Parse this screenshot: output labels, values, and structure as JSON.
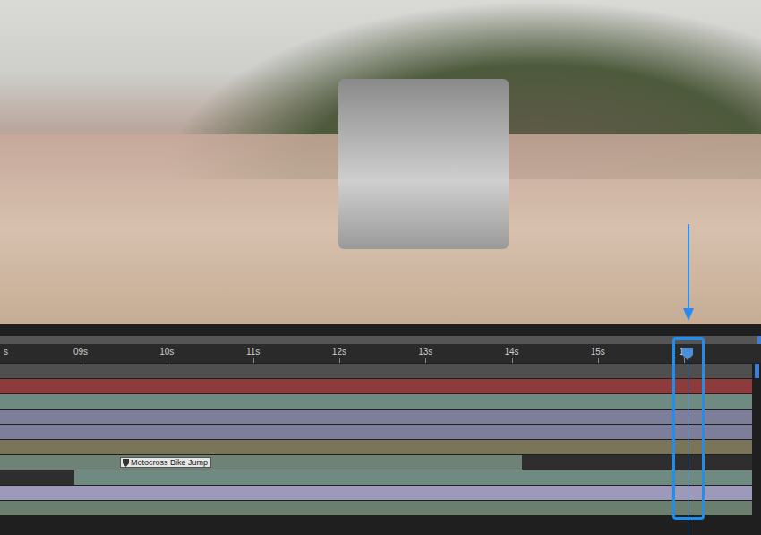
{
  "viewer": {
    "content": "photo"
  },
  "ruler": {
    "ticks": [
      "s",
      "09s",
      "10s",
      "11s",
      "12s",
      "13s",
      "14s",
      "15s",
      "16"
    ]
  },
  "playhead": {
    "highlighted": true
  },
  "tracks": [
    {
      "kind": "full",
      "color": "#4f4f4f",
      "selected": false
    },
    {
      "kind": "full",
      "color": "#8e3b3b",
      "selected": false
    },
    {
      "kind": "full",
      "color": "#6f8a80",
      "selected": false
    },
    {
      "kind": "full",
      "color": "#7d7f9a",
      "selected": false
    },
    {
      "kind": "full",
      "color": "#7d7f9a",
      "selected": false
    },
    {
      "kind": "full",
      "color": "#7a7459",
      "selected": false
    },
    {
      "kind": "trim-end",
      "color": "#6e8275",
      "selected": false,
      "marker": "Motocross Bike Jump"
    },
    {
      "kind": "trim-start",
      "color": "#6f8a80",
      "selected": false
    },
    {
      "kind": "full",
      "color": "#9c99bb",
      "selected": false
    },
    {
      "kind": "full",
      "color": "#6b7f6e",
      "selected": false
    }
  ]
}
